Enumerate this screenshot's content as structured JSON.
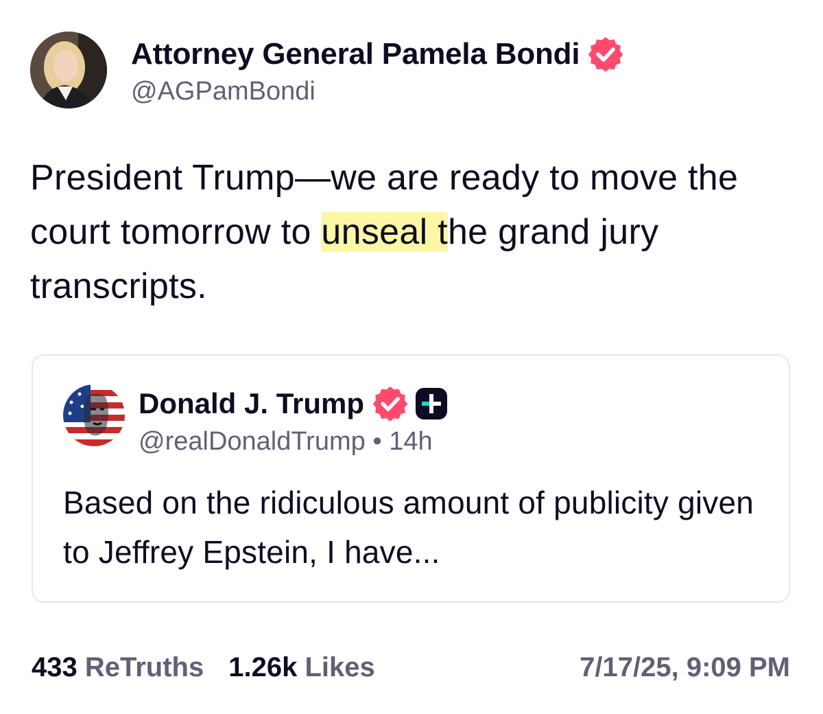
{
  "post": {
    "author": {
      "name": "Attorney General Pamela Bondi",
      "handle": "@AGPamBondi",
      "verified_icon": "verified-badge-icon",
      "verified_color": "#ff4a6f"
    },
    "text": {
      "before_highlight": "President Trump—we are ready to move the court tomorrow to ",
      "highlight": "unseal t",
      "after_highlight": "he grand jury transcripts.",
      "highlight_color": "#fcf7a4"
    },
    "quote": {
      "author": {
        "name": "Donald J. Trump",
        "handle": "@realDonaldTrump",
        "separator": "•",
        "time": "14h",
        "verified_icon": "verified-badge-icon",
        "plus_icon": "truth-plus-icon"
      },
      "text": "Based on the ridiculous amount of publicity given to Jeffrey Epstein, I have..."
    },
    "stats": {
      "retruths_count": "433",
      "retruths_label": "ReTruths",
      "likes_count": "1.26k",
      "likes_label": "Likes"
    },
    "timestamp": "7/17/25, 9:09 PM"
  },
  "colors": {
    "text_primary": "#0d0c22",
    "text_secondary": "#606076",
    "border": "#e7e7ec",
    "accent": "#ff4a6f"
  }
}
